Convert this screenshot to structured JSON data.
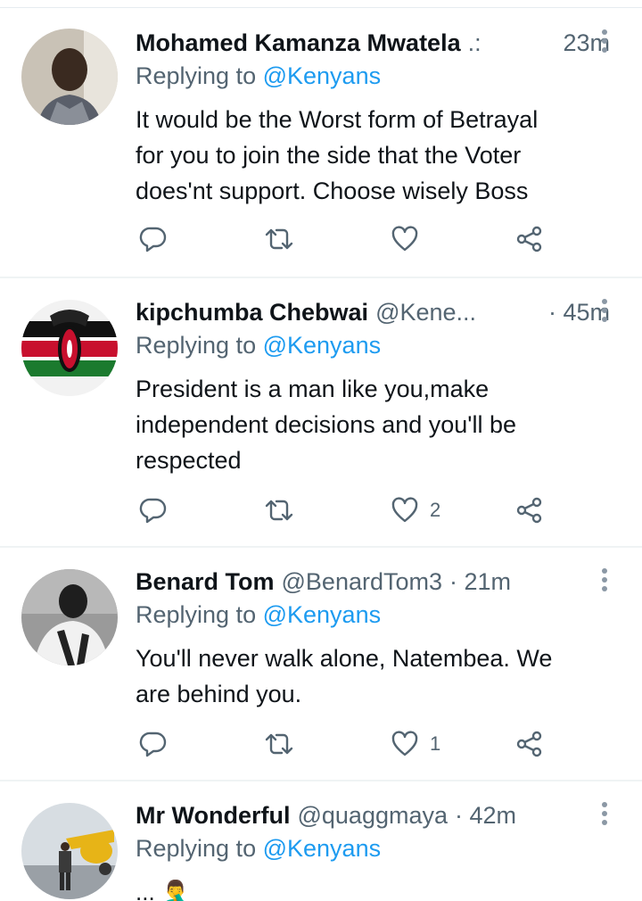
{
  "tweets": [
    {
      "name": "Mohamed Kamanza Mwatela",
      "handle": ".:",
      "time": "23m",
      "replying_prefix": "Replying to",
      "replying_to": "@Kenyans",
      "text": [
        "It would be the Worst form of Betrayal",
        "for you to join the side that the Voter",
        "does'nt support. Choose wisely Boss"
      ],
      "likes": "",
      "retweets": ""
    },
    {
      "name": "kipchumba Chebwai",
      "handle": "@Kene...",
      "time": "· 45m",
      "replying_prefix": "Replying to",
      "replying_to": "@Kenyans",
      "text": [
        "President is a man like you,make",
        "independent decisions and you'll be",
        "respected"
      ],
      "likes": "2",
      "retweets": ""
    },
    {
      "name": "Benard Tom",
      "handle": "@BenardTom3",
      "time": "· 21m",
      "replying_prefix": "Replying to",
      "replying_to": "@Kenyans",
      "text": [
        "You'll never walk alone, Natembea. We",
        "are behind you."
      ],
      "likes": "1",
      "retweets": ""
    },
    {
      "name": "Mr Wonderful",
      "handle": "@quaggmaya",
      "time": "· 42m",
      "replying_prefix": "Replying to",
      "replying_to": "@Kenyans",
      "text": [
        "... 🤦‍♂️"
      ],
      "likes": "",
      "retweets": ""
    }
  ],
  "icons": {
    "reply": "reply-icon",
    "retweet": "retweet-icon",
    "like": "heart-icon",
    "share": "share-icon",
    "more": "more-vertical-icon"
  },
  "colors": {
    "name": "#0f1419",
    "secondary": "#536471",
    "mention": "#1d9bf0",
    "divider": "#eff3f4"
  }
}
